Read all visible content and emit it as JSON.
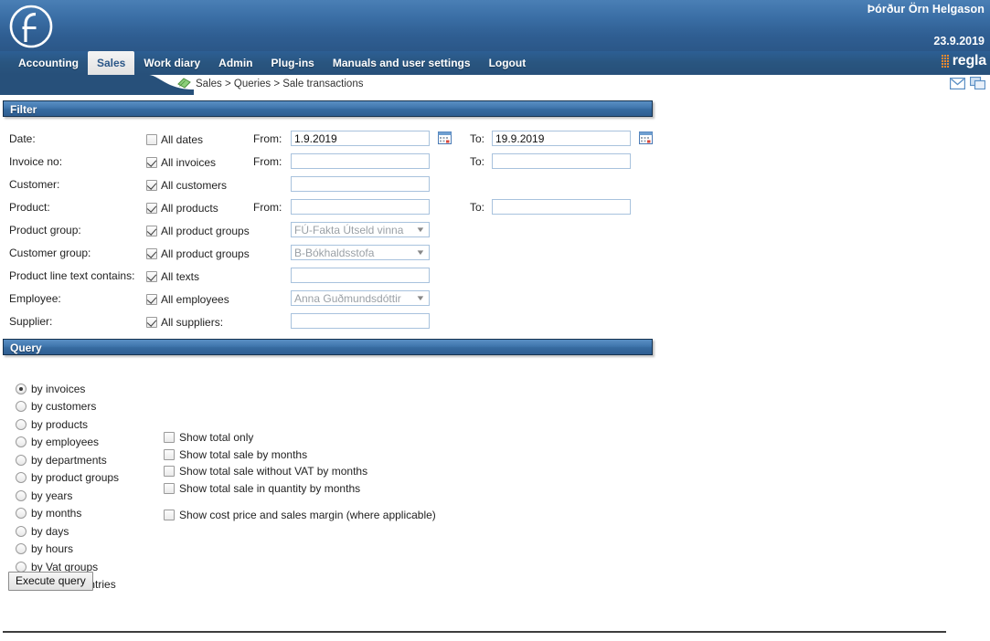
{
  "header": {
    "user_name": "Þórður Örn Helgason",
    "date": "23.9.2019",
    "brand": "regla",
    "logo_icon": "f-circle-logo"
  },
  "nav": {
    "items": [
      {
        "label": "Accounting",
        "active": false
      },
      {
        "label": "Sales",
        "active": true
      },
      {
        "label": "Work diary",
        "active": false
      },
      {
        "label": "Admin",
        "active": false
      },
      {
        "label": "Plug-ins",
        "active": false
      },
      {
        "label": "Manuals and user settings",
        "active": false
      },
      {
        "label": "Logout",
        "active": false
      }
    ]
  },
  "breadcrumb": {
    "icon": "money-icon",
    "text": "Sales > Queries > Sale transactions"
  },
  "topright_icons": [
    {
      "name": "mail-icon"
    },
    {
      "name": "windows-icon"
    }
  ],
  "filter": {
    "title": "Filter",
    "from_label": "From:",
    "to_label": "To:",
    "rows": [
      {
        "label": "Date:",
        "checkbox_label": "All dates",
        "checked": false,
        "from_value": "1.9.2019",
        "to_value": "19.9.2019",
        "has_from_label": true,
        "has_to_label": true,
        "has_calendar": true
      },
      {
        "label": "Invoice no:",
        "checkbox_label": "All invoices",
        "checked": true,
        "from_value": "",
        "to_value": "",
        "has_from_label": true,
        "has_to_label": true,
        "has_calendar": false
      },
      {
        "label": "Customer:",
        "checkbox_label": "All customers",
        "checked": true,
        "from_value": "",
        "to_value": null,
        "has_from_label": false,
        "has_to_label": false,
        "has_calendar": false
      },
      {
        "label": "Product:",
        "checkbox_label": "All products",
        "checked": true,
        "from_value": "",
        "to_value": "",
        "has_from_label": true,
        "has_to_label": true,
        "has_calendar": false
      }
    ],
    "select_rows": [
      {
        "label": "Product group:",
        "checkbox_label": "All product groups",
        "checked": true,
        "value": "FÚ-Fakta Útseld vinna",
        "type": "select"
      },
      {
        "label": "Customer group:",
        "checkbox_label": "All product groups",
        "checked": true,
        "value": "B-Bókhaldsstofa",
        "type": "select"
      },
      {
        "label": "Product line text contains:",
        "checkbox_label": "All texts",
        "checked": true,
        "value": "",
        "type": "text"
      },
      {
        "label": "Employee:",
        "checkbox_label": "All employees",
        "checked": true,
        "value": "Anna Guðmundsdóttir",
        "type": "select"
      },
      {
        "label": "Supplier:",
        "checkbox_label": "All suppliers:",
        "checked": true,
        "value": "",
        "type": "text"
      }
    ]
  },
  "query": {
    "title": "Query",
    "radios": [
      {
        "label": "by invoices",
        "selected": true
      },
      {
        "label": "by customers",
        "selected": false
      },
      {
        "label": "by products",
        "selected": false
      },
      {
        "label": "by employees",
        "selected": false
      },
      {
        "label": "by departments",
        "selected": false
      },
      {
        "label": "by product groups",
        "selected": false
      },
      {
        "label": "by years",
        "selected": false
      },
      {
        "label": "by months",
        "selected": false
      },
      {
        "label": "by days",
        "selected": false
      },
      {
        "label": "by hours",
        "selected": false
      },
      {
        "label": "by Vat groups",
        "selected": false
      },
      {
        "label": "by invoice entries",
        "selected": false
      }
    ],
    "checkboxes": [
      {
        "label": "Show total only",
        "checked": false,
        "spaced": false
      },
      {
        "label": "Show total sale by months",
        "checked": false,
        "spaced": false
      },
      {
        "label": "Show total sale without VAT by months",
        "checked": false,
        "spaced": false
      },
      {
        "label": "Show total sale in quantity by months",
        "checked": false,
        "spaced": false
      },
      {
        "label": "Show cost price and sales margin (where applicable)",
        "checked": false,
        "spaced": true
      }
    ],
    "execute_label": "Execute query"
  },
  "colors": {
    "header_blue": "#3a6ea5",
    "nav_blue": "#27507a",
    "section_bar": "#3e73aa",
    "input_border": "#a8c2dd",
    "accent_orange": "#f08a2e"
  }
}
